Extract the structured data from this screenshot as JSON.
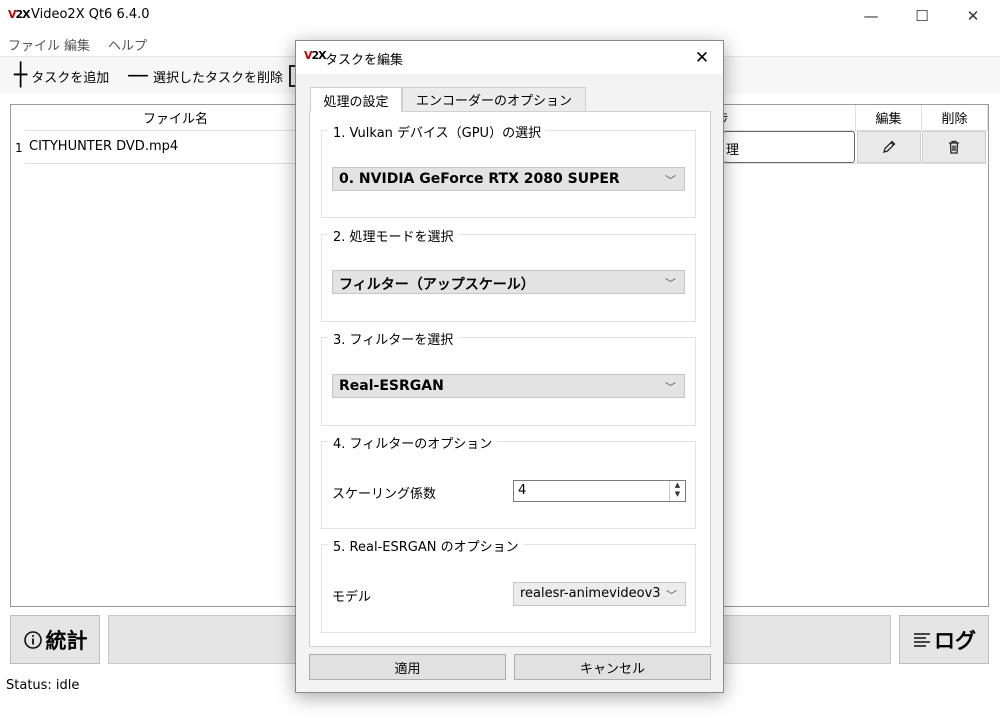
{
  "app": {
    "logo": "V2X",
    "title": "Video2X Qt6 6.4.0"
  },
  "window_controls": {
    "minimize": "—",
    "maximize": "☐",
    "close": "✕"
  },
  "menu": [
    "ファイル",
    "編集",
    "ヘルプ"
  ],
  "toolbar": {
    "add_label": "タスクを追加",
    "add_icon": "┼",
    "remove_label": "選択したタスクを削除",
    "remove_icon": "—"
  },
  "table": {
    "headers": {
      "filename": "ファイル名",
      "progress_partial": "捗",
      "edit": "編集",
      "delete": "削除"
    },
    "rows": [
      {
        "index": "1",
        "file": "CITYHUNTER DVD.mp4",
        "status_partial": "理"
      }
    ]
  },
  "bottom": {
    "stats_label": "統計",
    "log_label": "ログ"
  },
  "status": "Status: idle",
  "dialog": {
    "logo": "V2X",
    "title": "タスクを編集",
    "tabs": [
      "処理の設定",
      "エンコーダーのオプション"
    ],
    "groups": {
      "gpu": {
        "title": "1. Vulkan デバイス（GPU）の選択",
        "value": "0. NVIDIA GeForce RTX 2080 SUPER"
      },
      "mode": {
        "title": "2. 処理モードを選択",
        "value": "フィルター（アップスケール）"
      },
      "filter": {
        "title": "3. フィルターを選択",
        "value": "Real-ESRGAN"
      },
      "filter_options": {
        "title": "4. フィルターのオプション",
        "scale_label": "スケーリング係数",
        "scale_value": "4"
      },
      "esrgan_options": {
        "title": "5. Real-ESRGAN のオプション",
        "model_label": "モデル",
        "model_value": "realesr-animevideov3"
      }
    },
    "apply_label": "適用",
    "cancel_label": "キャンセル"
  }
}
